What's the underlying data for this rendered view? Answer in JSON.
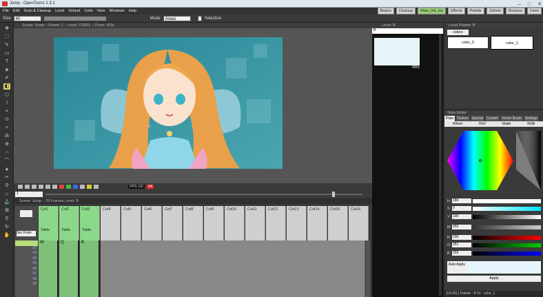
{
  "titlebar": {
    "title": "Jump - OpenToonz 1.3.1"
  },
  "menu": [
    "File",
    "Edit",
    "Scan & Cleanup",
    "Level",
    "Xsheet",
    "Cells",
    "View",
    "Windows",
    "Help"
  ],
  "rooms": [
    {
      "label": "Basics"
    },
    {
      "label": "Cleanup"
    },
    {
      "label": "Main_Ink_Ins"
    },
    {
      "label": "Effects"
    },
    {
      "label": "Palette"
    },
    {
      "label": "Xsheet"
    },
    {
      "label": "Browser"
    },
    {
      "label": "Farm"
    }
  ],
  "toolopts": {
    "size_label": "Size",
    "size_value": "40",
    "mode_label": "Mode",
    "mode_value": "Areas",
    "selective_label": "Selective"
  },
  "viewer": {
    "header": "Scene: Jump  ::  Frame: 1  ::  Level: 0.0001  ::  Zoom: 45%"
  },
  "frametoolbar": {
    "fps_label": "FPS 10/",
    "fps_value": "24"
  },
  "slider": {
    "frame": "1"
  },
  "xsheet": {
    "header": "Scene: Jump  ::  29 Frames  Level: B",
    "columns": [
      {
        "name": "Col1",
        "label": "Table",
        "level": "W",
        "used": true
      },
      {
        "name": "Col2",
        "label": "Table",
        "level": "Q",
        "used": true
      },
      {
        "name": "Col3",
        "label": "Table",
        "level": "B",
        "used": true
      },
      {
        "name": "Col4"
      },
      {
        "name": "Col5"
      },
      {
        "name": "Col6"
      },
      {
        "name": "Col7"
      },
      {
        "name": "Col8"
      },
      {
        "name": "Col9"
      },
      {
        "name": "Col10"
      },
      {
        "name": "Col11"
      },
      {
        "name": "Col12"
      },
      {
        "name": "Col13"
      },
      {
        "name": "Col14"
      },
      {
        "name": "Col15"
      },
      {
        "name": "Col16"
      }
    ],
    "rows": [
      "01",
      "02",
      "03",
      "04",
      "05",
      "06",
      "07",
      "08",
      "09"
    ],
    "selected_frame": "01"
  },
  "level": {
    "header": "Level: B",
    "filter": "B",
    "frame": "0001"
  },
  "palette": {
    "header": "Level Palette: B",
    "tab": "colors",
    "chips": [
      {
        "name": "color_0"
      },
      {
        "name": "color_1"
      }
    ]
  },
  "style_editor": {
    "header": "Style Editor",
    "tabs": [
      "Plain",
      "Texture",
      "Special",
      "Custom",
      "Vector Brush",
      "Settings"
    ],
    "subtabs": [
      "Wheel",
      "HSV",
      "Matte",
      "RGB"
    ],
    "channels": [
      {
        "label": "H",
        "value": "189"
      },
      {
        "label": "S",
        "value": "9"
      },
      {
        "label": "V",
        "value": "100"
      },
      {
        "label": "M",
        "value": "255"
      },
      {
        "label": "R",
        "value": "230"
      },
      {
        "label": "G",
        "value": "251"
      },
      {
        "label": "B",
        "value": "255"
      }
    ],
    "auto_apply": "Auto Apply",
    "apply": "Apply"
  },
  "status": {
    "text": "[LEVEL]  Palette : B  #1 : color_1"
  }
}
